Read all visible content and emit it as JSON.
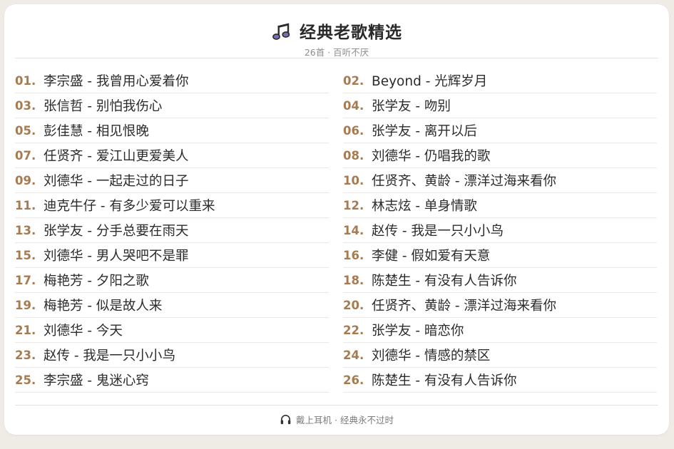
{
  "header": {
    "icon": "music-note-icon",
    "title": "经典老歌精选",
    "subtitle": "26首 · 百听不厌"
  },
  "colors": {
    "accent": "#a77b52",
    "icon_fill": "#7b6fb3",
    "icon_stroke": "#2b2b2b",
    "text": "#2b2b2b",
    "muted": "#8e8e8e"
  },
  "songs": [
    {
      "num": "01.",
      "text": "李宗盛 - 我曾用心爱着你"
    },
    {
      "num": "02.",
      "text": "Beyond - 光辉岁月"
    },
    {
      "num": "03.",
      "text": "张信哲 - 别怕我伤心"
    },
    {
      "num": "04.",
      "text": "张学友 - 吻别"
    },
    {
      "num": "05.",
      "text": "彭佳慧 - 相见恨晚"
    },
    {
      "num": "06.",
      "text": "张学友 - 离开以后"
    },
    {
      "num": "07.",
      "text": "任贤齐 - 爱江山更爱美人"
    },
    {
      "num": "08.",
      "text": "刘德华 - 仍唱我的歌"
    },
    {
      "num": "09.",
      "text": "刘德华 - 一起走过的日子"
    },
    {
      "num": "10.",
      "text": "任贤齐、黄龄 - 漂洋过海来看你"
    },
    {
      "num": "11.",
      "text": "迪克牛仔 - 有多少爱可以重来"
    },
    {
      "num": "12.",
      "text": "林志炫 - 单身情歌"
    },
    {
      "num": "13.",
      "text": "张学友 - 分手总要在雨天"
    },
    {
      "num": "14.",
      "text": "赵传 - 我是一只小小鸟"
    },
    {
      "num": "15.",
      "text": "刘德华 - 男人哭吧不是罪"
    },
    {
      "num": "16.",
      "text": "李健 - 假如爱有天意"
    },
    {
      "num": "17.",
      "text": "梅艳芳 - 夕阳之歌"
    },
    {
      "num": "18.",
      "text": "陈楚生 - 有没有人告诉你"
    },
    {
      "num": "19.",
      "text": "梅艳芳 - 似是故人来"
    },
    {
      "num": "20.",
      "text": "任贤齐、黄龄 - 漂洋过海来看你"
    },
    {
      "num": "21.",
      "text": "刘德华 - 今天"
    },
    {
      "num": "22.",
      "text": "张学友 - 暗恋你"
    },
    {
      "num": "23.",
      "text": "赵传 - 我是一只小小鸟"
    },
    {
      "num": "24.",
      "text": "刘德华 - 情感的禁区"
    },
    {
      "num": "25.",
      "text": "李宗盛 - 鬼迷心窍"
    },
    {
      "num": "26.",
      "text": "陈楚生 - 有没有人告诉你"
    }
  ],
  "footer": {
    "icon": "headphones-icon",
    "text": "戴上耳机 · 经典永不过时"
  }
}
